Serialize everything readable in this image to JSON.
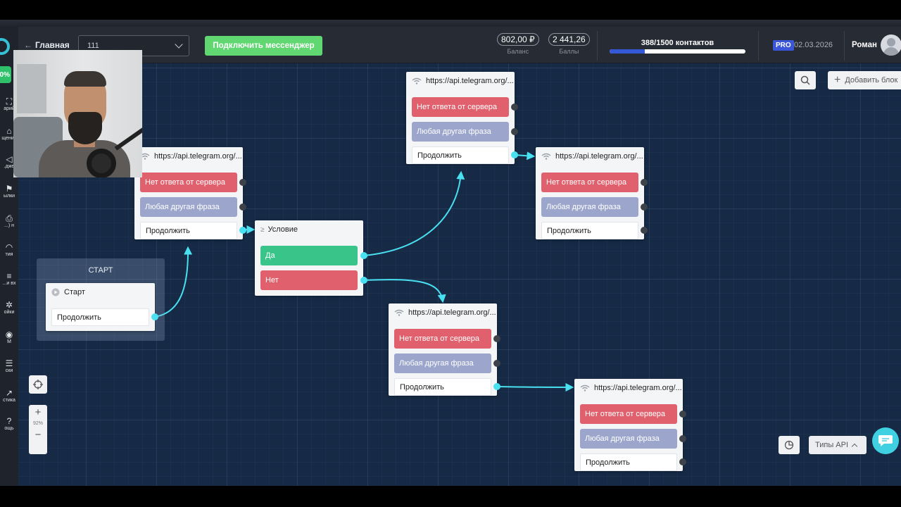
{
  "topbar": {
    "back_label": "Главная",
    "project_value": "111",
    "connect_label": "Подключить мессенджер",
    "balance_value": "802,00 ₽",
    "balance_label": "Баланс",
    "points_value": "2 441,26",
    "points_label": "Баллы",
    "contacts_text": "388/1500 контактов",
    "contacts_fraction": 0.259,
    "pro_label": "PRO",
    "date": "02.03.2026",
    "user_name": "Роман"
  },
  "sidebar": {
    "badge": "0%",
    "items": [
      {
        "icon": "flow-icon",
        "label": "арий"
      },
      {
        "icon": "messages-icon",
        "label": "щения"
      },
      {
        "icon": "widget-icon",
        "label": "джe."
      },
      {
        "icon": "mailing-icon",
        "label": "ылки"
      },
      {
        "icon": "shop-icon",
        "label": "н (..."
      },
      {
        "icon": "events-icon",
        "label": "тия"
      },
      {
        "icon": "lists-icon",
        "label": "и вх..."
      },
      {
        "icon": "settings-icon",
        "label": "ойки"
      },
      {
        "icon": "crm-icon",
        "label": "M"
      },
      {
        "icon": "lists2-icon",
        "label": "ски"
      },
      {
        "icon": "stats-icon",
        "label": "стика"
      },
      {
        "icon": "help-icon",
        "label": "ощь"
      }
    ]
  },
  "canvas": {
    "start_group_title": "СТАРТ",
    "start_node": {
      "title": "Старт",
      "continue": "Продолжить"
    },
    "condition_node": {
      "title": "Условие",
      "yes": "Да",
      "no": "Нет"
    },
    "api_nodes": [
      {
        "title": "https://api.telegram.org/...",
        "no_response": "Нет ответа от сервера",
        "other": "Любая другая фраза",
        "continue": "Продолжить"
      },
      {
        "title": "https://api.telegram.org/...",
        "no_response": "Нет ответа от сервера",
        "other": "Любая другая фраза",
        "continue": "Продолжить"
      },
      {
        "title": "https://api.telegram.org/...",
        "no_response": "Нет ответа от сервера",
        "other": "Любая другая фраза",
        "continue": "Продолжить"
      },
      {
        "title": "https://api.telegram.org/...",
        "no_response": "Нет ответа от сервера",
        "other": "Любая другая фраза",
        "continue": "Продолжить"
      },
      {
        "title": "https://api.telegram.org/...",
        "no_response": "Нет ответа от сервера",
        "other": "Любая другая фраза",
        "continue": "Продолжить"
      }
    ],
    "zoom_level": "92%",
    "add_block_label": "Добавить блок",
    "api_types_label": "Типы API"
  },
  "colors": {
    "canvas_bg": "#162a46",
    "red_button": "#e0616d",
    "lavender_button": "#9ca6cd",
    "green_button": "#39c489",
    "connector": "#49e1f1",
    "connect_button": "#61d772"
  }
}
